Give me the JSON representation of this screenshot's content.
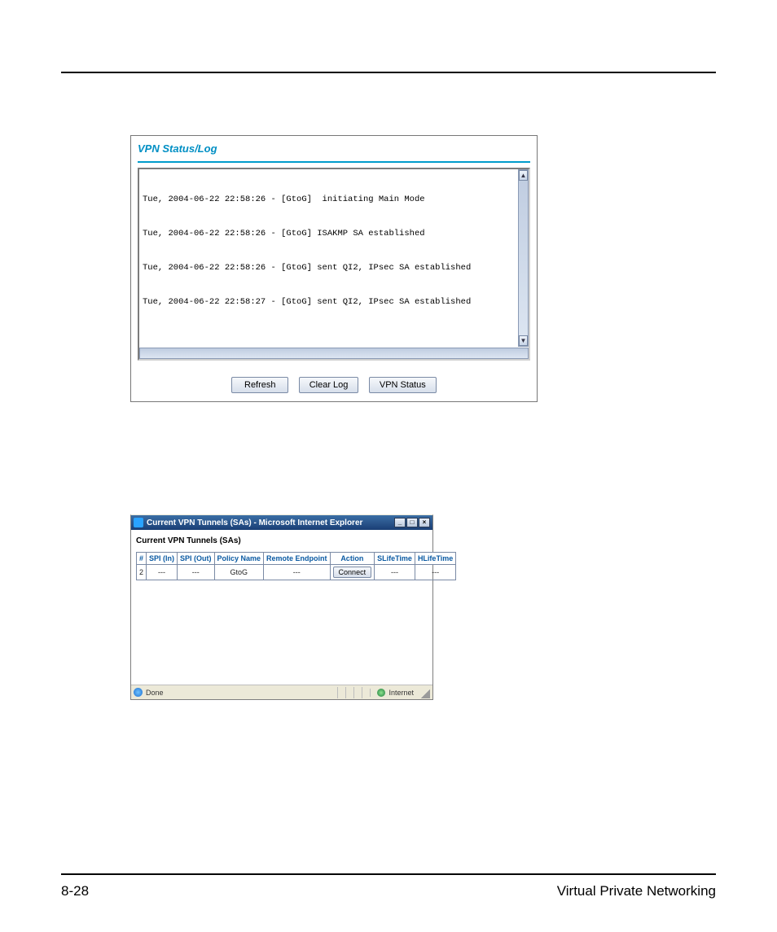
{
  "panel1": {
    "title": "VPN Status/Log",
    "log_lines": [
      "Tue, 2004-06-22 22:58:26 - [GtoG]  initiating Main Mode",
      "Tue, 2004-06-22 22:58:26 - [GtoG] ISAKMP SA established",
      "Tue, 2004-06-22 22:58:26 - [GtoG] sent QI2, IPsec SA established",
      "Tue, 2004-06-22 22:58:27 - [GtoG] sent QI2, IPsec SA established"
    ],
    "buttons": {
      "refresh": "Refresh",
      "clear": "Clear Log",
      "status": "VPN Status"
    }
  },
  "panel2": {
    "window_title": "Current VPN Tunnels (SAs) - Microsoft Internet Explorer",
    "heading": "Current VPN Tunnels (SAs)",
    "columns": {
      "num": "#",
      "spi_in": "SPI (In)",
      "spi_out": "SPI (Out)",
      "policy": "Policy Name",
      "remote": "Remote Endpoint",
      "action": "Action",
      "slife": "SLifeTime",
      "hlife": "HLifeTime"
    },
    "row": {
      "num": "2",
      "spi_in": "---",
      "spi_out": "---",
      "policy": "GtoG",
      "remote": "---",
      "action_label": "Connect",
      "slife": "---",
      "hlife": "---"
    },
    "status_done": "Done",
    "status_zone": "Internet"
  },
  "footer": {
    "page_num": "8-28",
    "chapter": "Virtual Private Networking"
  }
}
